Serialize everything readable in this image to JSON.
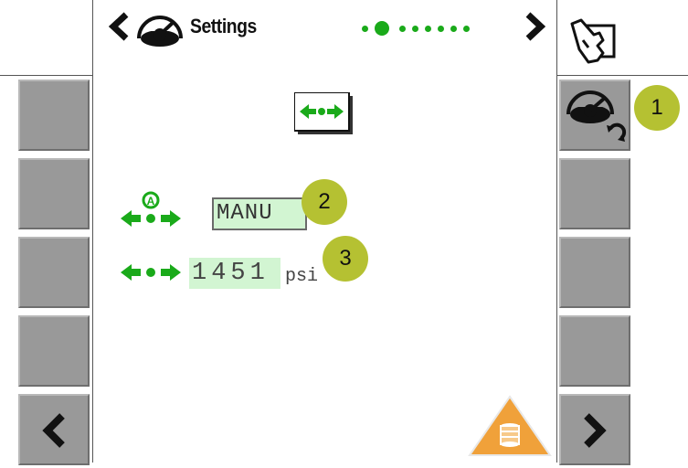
{
  "header": {
    "title": "Settings",
    "page_indicator": {
      "total": 8,
      "active": 1
    },
    "nav_icons": [
      "chevron-left-icon",
      "gauge-icon",
      "chevron-right-icon",
      "hand-on-key-icon"
    ]
  },
  "left_softkeys": {
    "count": 5,
    "bottom_icon": "chevron-left-icon"
  },
  "right_softkeys": {
    "count": 5,
    "top_icon": "gauge-refresh-icon",
    "bottom_icon": "chevron-right-icon"
  },
  "main": {
    "header_icon": "clamp-arrows-icon",
    "mode": {
      "icon": "auto-clamp-icon",
      "value": "MANU"
    },
    "pressure": {
      "icon": "clamp-arrows-icon",
      "value": "1451",
      "unit": "psi"
    },
    "warning_icon": "coil-warning-icon"
  },
  "callouts": [
    "1",
    "2",
    "3"
  ],
  "colors": {
    "accent_green": "#1aaa1a",
    "softkey_gray": "#999999",
    "callout": "#b5c132",
    "warning_orange": "#f0a13a",
    "field_bg": "#d2f5d2"
  }
}
